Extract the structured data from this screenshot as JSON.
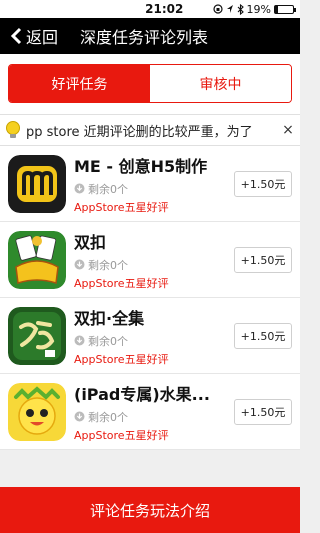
{
  "status_bar": {
    "time": "21:02",
    "battery": "19%",
    "battery_level": 0.19
  },
  "nav": {
    "back_label": "返回",
    "title": "深度任务评论列表"
  },
  "tabs": [
    {
      "label": "好评任务",
      "active": true
    },
    {
      "label": "审核中",
      "active": false
    }
  ],
  "notice": {
    "text": "pp store 近期评论删的比较严重，为了",
    "close": "×"
  },
  "items": [
    {
      "name": "ME - 创意H5制作",
      "remaining": "剩余0个",
      "tag": "AppStore五星好评",
      "reward": "+1.50元",
      "icon": "me-app-icon"
    },
    {
      "name": "双扣",
      "remaining": "剩余0个",
      "tag": "AppStore五星好评",
      "reward": "+1.50元",
      "icon": "shuangkou-app-icon"
    },
    {
      "name": "双扣·全集",
      "remaining": "剩余0个",
      "tag": "AppStore五星好评",
      "reward": "+1.50元",
      "icon": "shuangkou-quanji-app-icon"
    },
    {
      "name": "(iPad专属)水果...",
      "remaining": "剩余0个",
      "tag": "AppStore五星好评",
      "reward": "+1.50元",
      "icon": "fruit-app-icon"
    }
  ],
  "bottom": {
    "label": "评论任务玩法介绍"
  },
  "colors": {
    "accent": "#e8190f",
    "nav_bg": "#000000"
  }
}
